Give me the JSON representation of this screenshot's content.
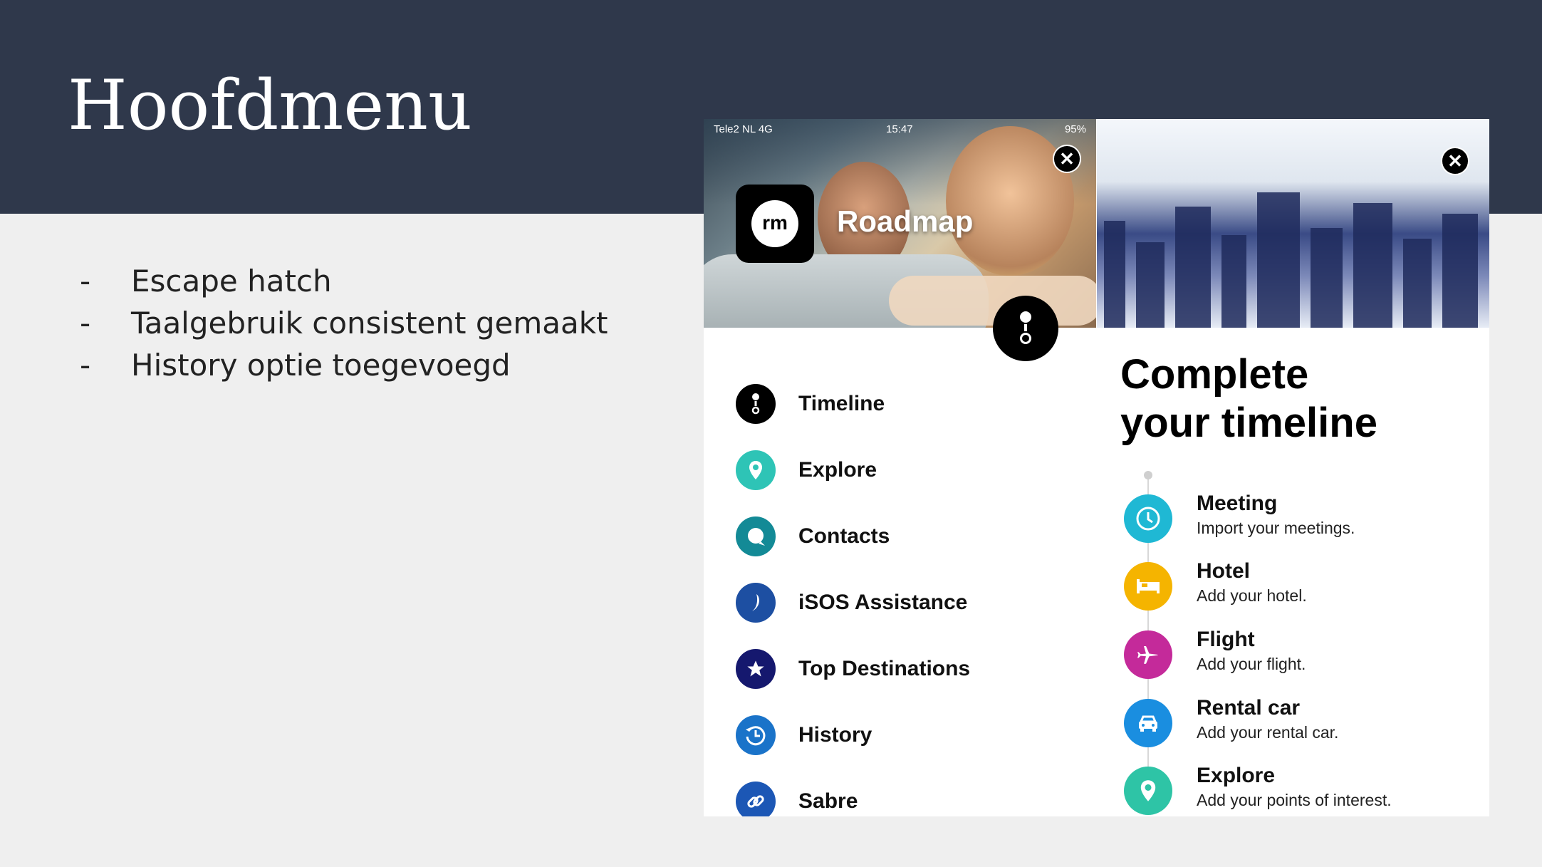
{
  "slide": {
    "title": "Hoofdmenu",
    "bullets": [
      {
        "dash": "-",
        "text": "Escape hatch"
      },
      {
        "dash": "-",
        "text": "Taalgebruik consistent gemaakt"
      },
      {
        "dash": "-",
        "text": "History optie toegevoegd"
      }
    ]
  },
  "left_screen": {
    "status": {
      "carrier": "Tele2 NL  4G",
      "time": "15:47",
      "battery": "95%"
    },
    "close_label": "✕",
    "logo_text": "rm",
    "app_name": "Roadmap",
    "menu": [
      {
        "label": "Timeline",
        "icon": "timeline-icon",
        "color": "#000000"
      },
      {
        "label": "Explore",
        "icon": "map-pin-icon",
        "color": "#2ec4b6"
      },
      {
        "label": "Contacts",
        "icon": "chat-bubble-icon",
        "color": "#138a96"
      },
      {
        "label": "iSOS Assistance",
        "icon": "isos-icon",
        "color": "#1d4fa2"
      },
      {
        "label": "Top Destinations",
        "icon": "star-icon",
        "color": "#15186e"
      },
      {
        "label": "History",
        "icon": "history-icon",
        "color": "#1a73c9"
      },
      {
        "label": "Sabre",
        "icon": "link-icon",
        "color": "#1c57b5"
      }
    ]
  },
  "right_screen": {
    "close_label": "✕",
    "title_line1": "Complete",
    "title_line2": "your timeline",
    "steps": [
      {
        "title": "Meeting",
        "subtitle": "Import your meetings.",
        "icon": "clock-icon",
        "color": "#1fb8d4"
      },
      {
        "title": "Hotel",
        "subtitle": "Add your hotel.",
        "icon": "bed-icon",
        "color": "#f5b400"
      },
      {
        "title": "Flight",
        "subtitle": "Add your flight.",
        "icon": "airplane-icon",
        "color": "#c42a9a"
      },
      {
        "title": "Rental car",
        "subtitle": "Add your rental car.",
        "icon": "car-icon",
        "color": "#1a8ee0"
      },
      {
        "title": "Explore",
        "subtitle": "Add your points of interest.",
        "icon": "map-pin-icon",
        "color": "#2ec4a6"
      }
    ]
  }
}
